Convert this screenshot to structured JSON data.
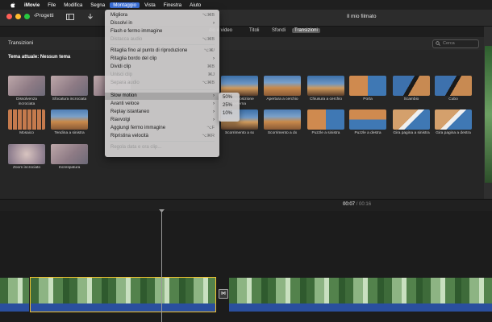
{
  "menubar": {
    "items": [
      "iMovie",
      "File",
      "Modifica",
      "Segna",
      "Montaggio",
      "Vista",
      "Finestra",
      "Aiuto"
    ],
    "active_index": 4
  },
  "toolbar": {
    "back_label": "Progetti",
    "window_title": "Il mio filmato"
  },
  "tabs": [
    "dio e video",
    "Titoli",
    "Sfondi",
    "Transizioni"
  ],
  "selected_tab_index": 3,
  "browser": {
    "header_label": "Transizioni",
    "search_placeholder": "Cerca",
    "theme_label": "Tema attuale: Nessun tema",
    "tiles": [
      {
        "caption": "Dissolvenza incrociata",
        "style": "blur"
      },
      {
        "caption": "Sfocatura incrociata",
        "style": "blur"
      },
      {
        "caption": "Diss",
        "style": "blur"
      },
      {
        "caption": "Mosaico",
        "style": "grid"
      },
      {
        "caption": "Tendina a sinistra",
        "style": "rock"
      },
      {
        "caption": "Zoom incrociato",
        "style": "zoom"
      },
      {
        "caption": "Increspatura",
        "style": "blur"
      },
      {
        "caption": "Sovrapposizione esterna",
        "style": "rock2"
      },
      {
        "caption": "Apertura a cerchio",
        "style": "rock"
      },
      {
        "caption": "Chiusura a cerchio",
        "style": "rock2"
      },
      {
        "caption": "Porta",
        "style": "split"
      },
      {
        "caption": "Scambio",
        "style": "cube"
      },
      {
        "caption": "Cubo",
        "style": "cube"
      },
      {
        "caption": "Scorrimento a sx",
        "style": "rock2"
      },
      {
        "caption": "Scorrimento a dx",
        "style": "rock"
      },
      {
        "caption": "Puzzle a sinistra",
        "style": "split"
      },
      {
        "caption": "Puzzle a destra",
        "style": "split2"
      },
      {
        "caption": "Gira pagina a sinistra",
        "style": "page"
      },
      {
        "caption": "Gira pagina a destra",
        "style": "page"
      }
    ]
  },
  "timeline": {
    "current": "00:07",
    "separator": "/",
    "total": "00:16"
  },
  "menu": {
    "items": [
      {
        "label": "Migliora",
        "shortcut": "⌥⌘B",
        "disabled": false
      },
      {
        "label": "Dissolvi in",
        "arrow": true,
        "disabled": false
      },
      {
        "label": "Flash e fermo immagine",
        "disabled": false
      },
      {
        "label": "Distacca audio",
        "shortcut": "⌥⌘B",
        "disabled": true
      },
      {
        "label": "Ritaglia fino al punto di riproduzione",
        "shortcut": "⌥⌘/",
        "disabled": false
      },
      {
        "label": "Ritaglia bordo del clip",
        "arrow": true,
        "disabled": false
      },
      {
        "label": "Dividi clip",
        "shortcut": "⌘B",
        "disabled": false
      },
      {
        "label": "Unisci clip",
        "shortcut": "⌘J",
        "disabled": true
      },
      {
        "label": "Separa audio",
        "shortcut": "⌥⌘B",
        "disabled": true
      },
      {
        "label": "Slow motion",
        "arrow": true,
        "disabled": false,
        "highlight": true
      },
      {
        "label": "Avanti veloce",
        "arrow": true,
        "disabled": false
      },
      {
        "label": "Replay istantaneo",
        "arrow": true,
        "disabled": false
      },
      {
        "label": "Riavvolgi",
        "arrow": true,
        "disabled": false
      },
      {
        "label": "Aggiungi fermo immagine",
        "shortcut": "⌥F",
        "disabled": false
      },
      {
        "label": "Ripristina velocità",
        "shortcut": "⌥⌘R",
        "disabled": false
      },
      {
        "label": "Regola data e ora clip...",
        "disabled": true
      }
    ]
  },
  "submenu": {
    "items": [
      "50%",
      "25%",
      "10%"
    ]
  },
  "colors": {
    "accent": "#3a6fd8",
    "clip_selection": "#f2c230",
    "audio_track": "#2a4f9e"
  }
}
